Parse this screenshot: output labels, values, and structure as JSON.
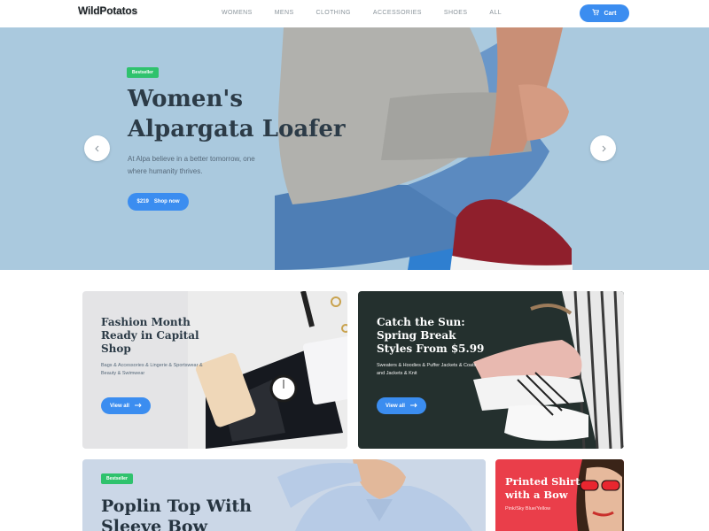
{
  "header": {
    "logo": "WildPotatos",
    "nav": [
      "WOMENS",
      "MENS",
      "CLOTHING",
      "ACCESSORIES",
      "SHOES",
      "ALL"
    ],
    "cart_label": "Cart"
  },
  "hero": {
    "badge": "Bestseller",
    "title": "Women's Alpargata Loafer",
    "subtitle": "At Alpa believe in a better tomorrow, one where humanity thrives.",
    "price": "$219",
    "cta": "Shop now"
  },
  "promos": [
    {
      "title": "Fashion Month Ready in Capital Shop",
      "text": "Bags & Accessories & Lingerie & Sportswear & Beauty & Swimwear",
      "cta": "View all"
    },
    {
      "title": "Catch the Sun: Spring Break Styles From $5.99",
      "text": "Sweaters & Hoodies & Puffer Jackets & Coats and Jackets & Knit",
      "cta": "View all"
    }
  ],
  "feature": {
    "badge": "Bestseller",
    "title": "Poplin Top With Sleeve Bow"
  },
  "side_promo": {
    "title": "Printed Shirt with a Bow",
    "text": "Pink/Sky Blue/Yellow"
  },
  "colors": {
    "accent": "#3b8df0",
    "badge": "#2fc26d",
    "hero_bg": "#aac9de",
    "side_promo_bg": "#ea3e4a"
  }
}
